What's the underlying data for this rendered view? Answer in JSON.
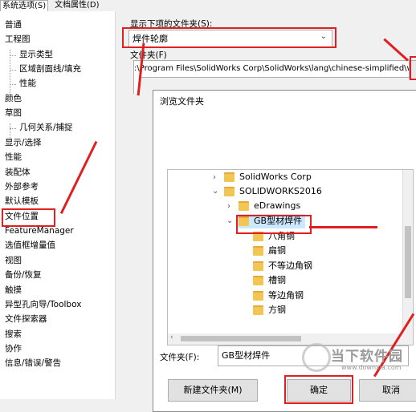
{
  "tabs": [
    {
      "label": "系统选项(S)",
      "active": true
    },
    {
      "label": "文档属性(D)",
      "active": false
    }
  ],
  "sidebar": {
    "items": [
      {
        "label": "普通",
        "level": 0
      },
      {
        "label": "工程图",
        "level": 0
      },
      {
        "label": "显示类型",
        "level": 1
      },
      {
        "label": "区域剖面线/填充",
        "level": 1
      },
      {
        "label": "性能",
        "level": 1
      },
      {
        "label": "颜色",
        "level": 0
      },
      {
        "label": "草图",
        "level": 0
      },
      {
        "label": "几何关系/捕捉",
        "level": 1
      },
      {
        "label": "显示/选择",
        "level": 0
      },
      {
        "label": "性能",
        "level": 0
      },
      {
        "label": "装配体",
        "level": 0
      },
      {
        "label": "外部参考",
        "level": 0
      },
      {
        "label": "默认模板",
        "level": 0
      },
      {
        "label": "文件位置",
        "level": 0
      },
      {
        "label": "FeatureManager",
        "level": 0
      },
      {
        "label": "选值框增量值",
        "level": 0
      },
      {
        "label": "视图",
        "level": 0
      },
      {
        "label": "备份/恢复",
        "level": 0
      },
      {
        "label": "触摸",
        "level": 0
      },
      {
        "label": "异型孔向导/Toolbox",
        "level": 0
      },
      {
        "label": "文件探索器",
        "level": 0
      },
      {
        "label": "搜索",
        "level": 0
      },
      {
        "label": "协作",
        "level": 0
      },
      {
        "label": "信息/错误/警告",
        "level": 0
      }
    ]
  },
  "main": {
    "show_folders_label": "显示下项的文件夹(S):",
    "show_folders_value": "焊件轮廓",
    "folders_label": "文件夹(F)",
    "folder_path": ":\\Program Files\\SolidWorks Corp\\SolidWorks\\lang\\chinese-simplified\\w"
  },
  "dialog": {
    "title": "浏览文件夹",
    "tree": [
      {
        "label": "SolidWorks Corp",
        "level": 0,
        "chevron": "right"
      },
      {
        "label": "SOLIDWORKS2016",
        "level": 0,
        "chevron": "down"
      },
      {
        "label": "eDrawings",
        "level": 1,
        "chevron": "right"
      },
      {
        "label": "GB型材焊件",
        "level": 1,
        "chevron": "down",
        "selected": true
      },
      {
        "label": "八角钢",
        "level": 2,
        "chevron": ""
      },
      {
        "label": "扁钢",
        "level": 2,
        "chevron": ""
      },
      {
        "label": "不等边角钢",
        "level": 2,
        "chevron": ""
      },
      {
        "label": "槽钢",
        "level": 2,
        "chevron": ""
      },
      {
        "label": "等边角钢",
        "level": 2,
        "chevron": ""
      },
      {
        "label": "方钢",
        "level": 2,
        "chevron": ""
      }
    ],
    "folder_field_label": "文件夹(F):",
    "folder_field_value": "GB型材焊件",
    "new_folder_button": "新建文件夹(M)",
    "ok_button": "确定",
    "cancel_button": "取消"
  },
  "watermark": {
    "brand": "当下软件园",
    "url": "www.downxia.com"
  },
  "colors": {
    "annotation_red": "#e02020",
    "selection_blue": "#cce8ff",
    "folder_yellow": "#f3c552"
  }
}
